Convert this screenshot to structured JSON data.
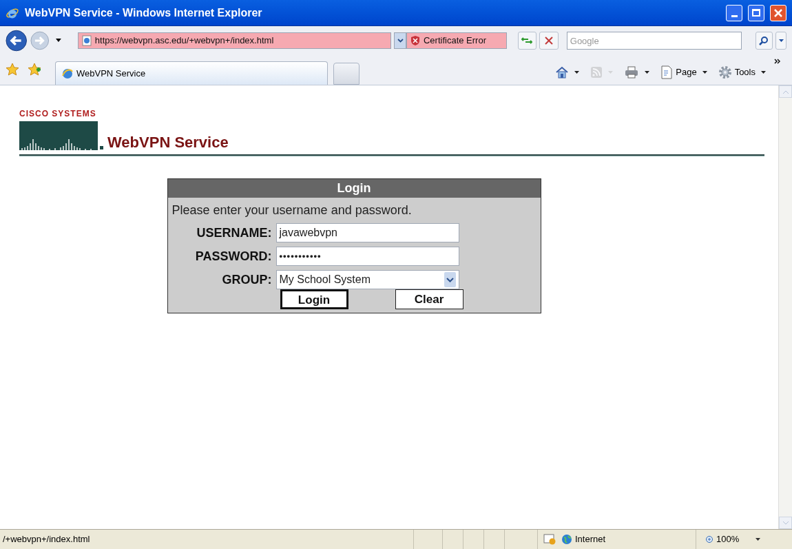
{
  "window": {
    "title": "WebVPN Service - Windows Internet Explorer"
  },
  "address_bar": {
    "url": "https://webvpn.asc.edu/+webvpn+/index.html",
    "certificate_error": "Certificate Error"
  },
  "search": {
    "placeholder": "Google"
  },
  "tabs": [
    {
      "label": "WebVPN Service",
      "selected": true
    }
  ],
  "command_bar": [
    {
      "kind": "home",
      "disabled": false
    },
    {
      "kind": "feeds",
      "disabled": true
    },
    {
      "kind": "print",
      "disabled": false
    },
    {
      "kind": "page",
      "label": "Page",
      "disabled": false
    },
    {
      "kind": "tools",
      "label": "Tools",
      "disabled": false
    }
  ],
  "page": {
    "brand": "CISCO SYSTEMS",
    "heading": "WebVPN Service",
    "login": {
      "title": "Login",
      "prompt": "Please enter your username and password.",
      "fields": [
        {
          "kind": "text",
          "label": "USERNAME:",
          "value": "javawebvpn"
        },
        {
          "kind": "password",
          "label": "PASSWORD:",
          "value": "•••••••••••"
        },
        {
          "kind": "select",
          "label": "GROUP:",
          "value": "My School System"
        }
      ],
      "buttons": [
        {
          "label": "Login",
          "default": true
        },
        {
          "label": "Clear",
          "default": false
        }
      ]
    }
  },
  "status_bar": {
    "text": "/+webvpn+/index.html",
    "zone": "Internet",
    "zoom": "100%"
  }
}
